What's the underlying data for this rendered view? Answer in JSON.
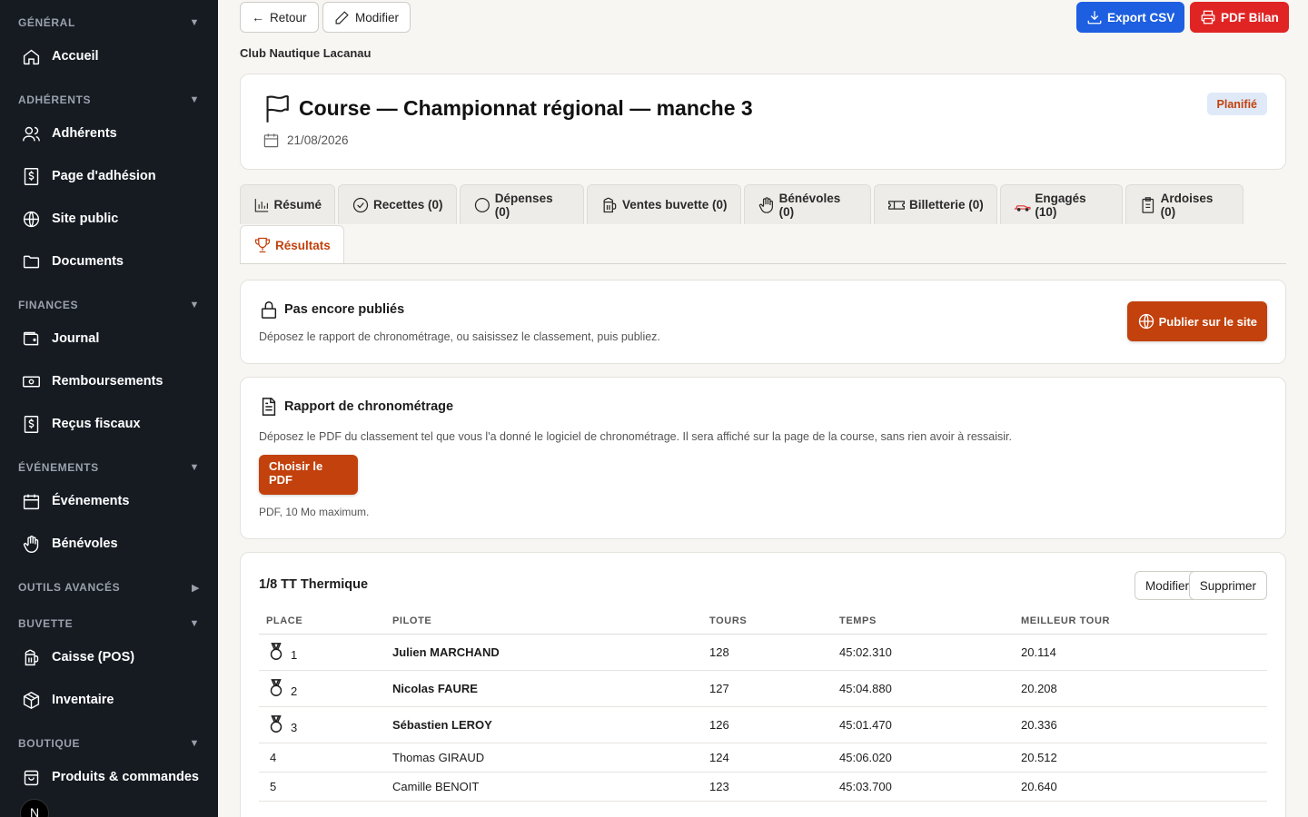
{
  "sidebar": {
    "sections": [
      {
        "label": "GÉNÉRAL",
        "caret": "▼",
        "items": [
          {
            "label": "Accueil",
            "icon": "home-icon"
          }
        ]
      },
      {
        "label": "ADHÉRENTS",
        "caret": "▼",
        "items": [
          {
            "label": "Adhérents",
            "icon": "users-icon"
          },
          {
            "label": "Page d'adhésion",
            "icon": "dollar-doc-icon"
          },
          {
            "label": "Site public",
            "icon": "globe-icon"
          },
          {
            "label": "Documents",
            "icon": "folder-icon"
          }
        ]
      },
      {
        "label": "FINANCES",
        "caret": "▼",
        "items": [
          {
            "label": "Journal",
            "icon": "wallet-icon"
          },
          {
            "label": "Remboursements",
            "icon": "banknote-icon"
          },
          {
            "label": "Reçus fiscaux",
            "icon": "dollar-doc-icon"
          }
        ]
      },
      {
        "label": "ÉVÉNEMENTS",
        "caret": "▼",
        "items": [
          {
            "label": "Événements",
            "icon": "calendar-icon"
          },
          {
            "label": "Bénévoles",
            "icon": "hand-icon"
          }
        ]
      },
      {
        "label": "OUTILS AVANCÉS",
        "caret": "▶",
        "items": []
      },
      {
        "label": "BUVETTE",
        "caret": "▼",
        "items": [
          {
            "label": "Caisse (POS)",
            "icon": "beer-icon"
          },
          {
            "label": "Inventaire",
            "icon": "box-icon"
          }
        ]
      },
      {
        "label": "BOUTIQUE",
        "caret": "▼",
        "items": [
          {
            "label": "Produits & commandes",
            "icon": "bag-icon"
          }
        ]
      }
    ],
    "avatar_letter": "N"
  },
  "toolbar": {
    "back_label": "Retour",
    "back_arrow": "←",
    "edit_label": "Modifier",
    "export_label": "Export CSV",
    "pdf_label": "PDF Bilan"
  },
  "colors": {
    "export": "#1d5fe0",
    "pdf": "#e02424",
    "accent": "#c2410c"
  },
  "club_name": "Club Nautique Lacanau",
  "event": {
    "title": "Course — Championnat régional — manche 3",
    "date": "21/08/2026",
    "status": "Planifié"
  },
  "tabs": [
    {
      "label": "Résumé",
      "icon": "chart-icon"
    },
    {
      "label": "Recettes (0)",
      "icon": "check-circle-icon"
    },
    {
      "label": "Dépenses (0)",
      "icon": "circle-icon"
    },
    {
      "label": "Ventes buvette (0)",
      "icon": "beer-icon"
    },
    {
      "label": "Bénévoles (0)",
      "icon": "hand-icon"
    },
    {
      "label": "Billetterie (0)",
      "icon": "ticket-icon"
    },
    {
      "label": "Engagés (10)",
      "icon": "race-car-icon"
    },
    {
      "label": "Ardoises (0)",
      "icon": "clipboard-icon"
    },
    {
      "label": "Résultats",
      "icon": "trophy-icon"
    }
  ],
  "publish": {
    "title": "Pas encore publiés",
    "description": "Déposez le rapport de chronométrage, ou saisissez le classement, puis publiez.",
    "button": "Publier sur le site"
  },
  "report": {
    "title": "Rapport de chronométrage",
    "description": "Déposez le PDF du classement tel que vous l'a donné le logiciel de chronométrage. Il sera affiché sur la page de la course, sans rien avoir à ressaisir.",
    "button": "Choisir le PDF",
    "hint": "PDF, 10 Mo maximum."
  },
  "results": {
    "title": "1/8 TT Thermique",
    "edit_label": "Modifier",
    "delete_label": "Supprimer",
    "columns": [
      "PLACE",
      "PILOTE",
      "TOURS",
      "TEMPS",
      "MEILLEUR TOUR"
    ],
    "rows": [
      {
        "place": "1",
        "pilot": "Julien MARCHAND",
        "laps": "128",
        "time": "45:02.310",
        "best": "20.114"
      },
      {
        "place": "2",
        "pilot": "Nicolas FAURE",
        "laps": "127",
        "time": "45:04.880",
        "best": "20.208"
      },
      {
        "place": "3",
        "pilot": "Sébastien LEROY",
        "laps": "126",
        "time": "45:01.470",
        "best": "20.336"
      },
      {
        "place": "4",
        "pilot": "Thomas GIRAUD",
        "laps": "124",
        "time": "45:06.020",
        "best": "20.512"
      },
      {
        "place": "5",
        "pilot": "Camille BENOIT",
        "laps": "123",
        "time": "45:03.700",
        "best": "20.640"
      }
    ]
  }
}
